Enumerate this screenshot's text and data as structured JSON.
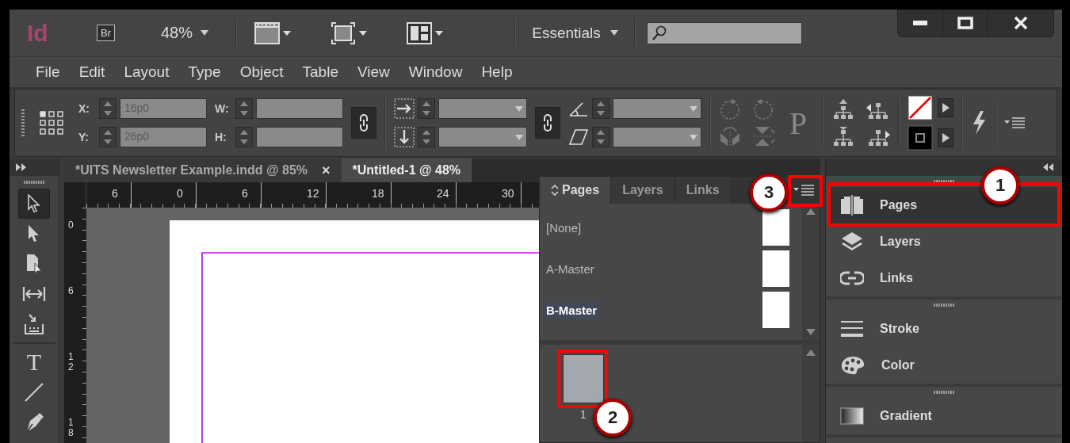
{
  "title_bar": {
    "app_logo": "Id",
    "bridge_button": "Br",
    "zoom": "48%",
    "workspace": "Essentials"
  },
  "menu": [
    "File",
    "Edit",
    "Layout",
    "Type",
    "Object",
    "Table",
    "View",
    "Window",
    "Help"
  ],
  "control_panel": {
    "position_fields": [
      {
        "label": "X:",
        "value": "16p0"
      },
      {
        "label": "Y:",
        "value": "26p0"
      }
    ],
    "size_fields": [
      {
        "label": "W:"
      },
      {
        "label": "H:"
      }
    ],
    "proxy_glyph": "P"
  },
  "tools": [
    {
      "kind": "selection",
      "selected": true
    },
    {
      "kind": "direct-selection",
      "selected": false
    },
    {
      "kind": "page",
      "selected": false
    },
    {
      "kind": "gap",
      "selected": false
    },
    {
      "kind": "collector",
      "selected": false
    },
    {
      "kind": "type",
      "glyph": "T",
      "selected": false
    },
    {
      "kind": "line",
      "selected": false
    },
    {
      "kind": "pen",
      "selected": false
    }
  ],
  "document_tabs": [
    {
      "title": "*UITS Newsletter Example.indd @ 85%",
      "close": "×",
      "selected": false
    },
    {
      "title": "*Untitled-1 @ 48%",
      "selected": true
    }
  ],
  "horizontal_ruler": [
    "6",
    "0",
    "6",
    "12",
    "18",
    "24",
    "30"
  ],
  "vertical_ruler": [
    "0",
    "6",
    "12",
    "18"
  ],
  "pages_panel": {
    "tabs": [
      {
        "label": "Pages",
        "selected": true
      },
      {
        "label": "Layers",
        "selected": false
      },
      {
        "label": "Links",
        "selected": false
      }
    ],
    "menu_callout": "3",
    "masters": [
      {
        "name": "[None]",
        "selected": false
      },
      {
        "name": "A-Master",
        "selected": false
      },
      {
        "name": "B-Master",
        "selected": true
      }
    ],
    "pages": [
      {
        "number": "1",
        "callout": "2"
      }
    ]
  },
  "dock": {
    "groups": [
      {
        "items": [
          {
            "kind": "pages",
            "label": "Pages",
            "selected": true,
            "callout": "1"
          },
          {
            "kind": "layers",
            "label": "Layers",
            "selected": false
          },
          {
            "kind": "links",
            "label": "Links",
            "selected": false
          }
        ]
      },
      {
        "items": [
          {
            "kind": "stroke",
            "label": "Stroke",
            "selected": false
          },
          {
            "kind": "color",
            "label": "Color",
            "selected": false
          }
        ]
      },
      {
        "items": [
          {
            "kind": "gradient",
            "label": "Gradient",
            "selected": false
          }
        ]
      }
    ]
  }
}
